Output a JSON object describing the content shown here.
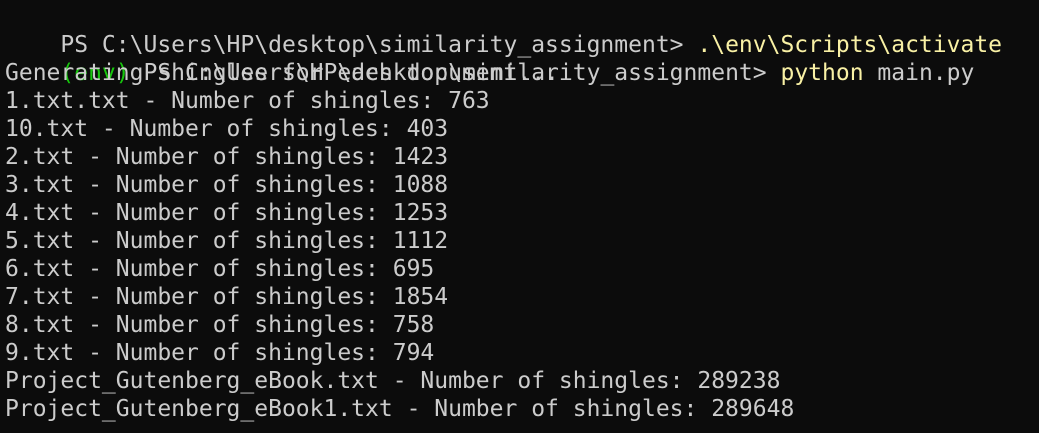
{
  "colors": {
    "background": "#0c0c0c",
    "text": "#cccccc",
    "command": "#f9f1a5",
    "venv": "#16c60c"
  },
  "lines": [
    {
      "prefix": "",
      "prompt": "PS C:\\Users\\HP\\desktop\\similarity_assignment> ",
      "command": ".\\env\\Scripts\\activate",
      "args": ""
    },
    {
      "prefix": "(env)",
      "prompt": " PS C:\\Users\\HP\\desktop\\similarity_assignment> ",
      "command": "python",
      "args": " main.py"
    }
  ],
  "output": [
    "Generating shingles for each document...",
    "1.txt.txt - Number of shingles: 763",
    "10.txt - Number of shingles: 403",
    "2.txt - Number of shingles: 1423",
    "3.txt - Number of shingles: 1088",
    "4.txt - Number of shingles: 1253",
    "5.txt - Number of shingles: 1112",
    "6.txt - Number of shingles: 695",
    "7.txt - Number of shingles: 1854",
    "8.txt - Number of shingles: 758",
    "9.txt - Number of shingles: 794",
    "Project_Gutenberg_eBook.txt - Number of shingles: 289238",
    "Project_Gutenberg_eBook1.txt - Number of shingles: 289648"
  ]
}
